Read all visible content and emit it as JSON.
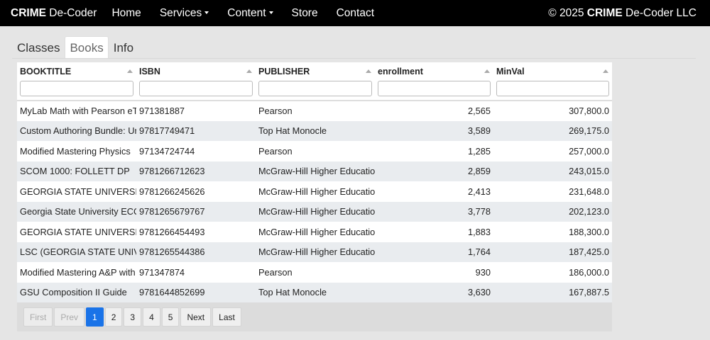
{
  "nav": {
    "brand_bold": "CRIME",
    "brand_rest": " De-Coder",
    "links": [
      "Home",
      "Services",
      "Content",
      "Store",
      "Contact"
    ],
    "copyright_prefix": "© 2025 ",
    "copyright_bold": "CRIME",
    "copyright_rest": " De-Coder LLC"
  },
  "tabs": [
    "Classes",
    "Books",
    "Info"
  ],
  "active_tab": "Books",
  "table": {
    "columns": [
      "BOOKTITLE",
      "ISBN",
      "PUBLISHER",
      "enrollment",
      "MinVal"
    ],
    "rows": [
      [
        "MyLab Math with Pearson eText",
        "971381887",
        "Pearson",
        "2,565",
        "307,800.0"
      ],
      [
        "Custom Authoring Bundle: Unlimited",
        "97817749471",
        "Top Hat Monocle",
        "3,589",
        "269,175.0"
      ],
      [
        "Modified Mastering Physics",
        "97134724744",
        "Pearson",
        "1,285",
        "257,000.0"
      ],
      [
        "SCOM 1000: FOLLETT DP",
        "9781266712623",
        "McGraw-Hill Higher Education",
        "2,859",
        "243,015.0"
      ],
      [
        "GEORGIA STATE UNIVERSITY",
        "9781266245626",
        "McGraw-Hill Higher Education",
        "2,413",
        "231,648.0"
      ],
      [
        "Georgia State University ECON",
        "9781265679767",
        "McGraw-Hill Higher Education",
        "3,778",
        "202,123.0"
      ],
      [
        "GEORGIA STATE UNIVERSITY",
        "9781266454493",
        "McGraw-Hill Higher Education",
        "1,883",
        "188,300.0"
      ],
      [
        "LSC (GEORGIA STATE UNIVERSITY)",
        "9781265544386",
        "McGraw-Hill Higher Education",
        "1,764",
        "187,425.0"
      ],
      [
        "Modified Mastering A&P with",
        "971347874",
        "Pearson",
        "930",
        "186,000.0"
      ],
      [
        "GSU Composition II Guide",
        "9781644852699",
        "Top Hat Monocle",
        "3,630",
        "167,887.5"
      ]
    ]
  },
  "pager": {
    "first": "First",
    "prev": "Prev",
    "pages": [
      "1",
      "2",
      "3",
      "4",
      "5"
    ],
    "current": "1",
    "next": "Next",
    "last": "Last"
  }
}
